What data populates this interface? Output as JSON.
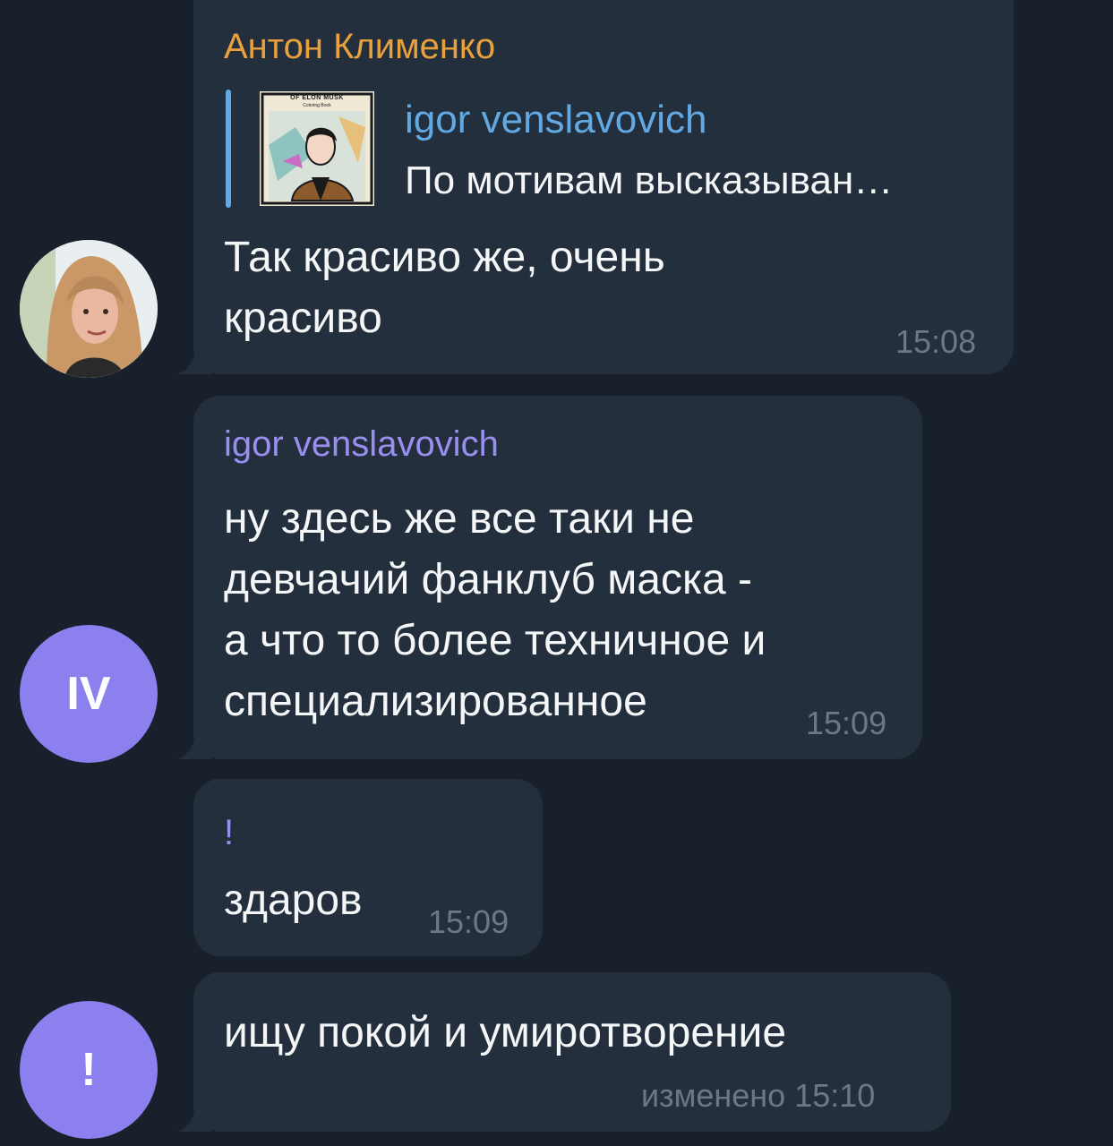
{
  "messages": [
    {
      "sender": "Антон Клименко",
      "sender_color": "#e8a13c",
      "reply": {
        "author": "igor venslavovich",
        "text": "По мотивам высказыван…",
        "thumb_title": "OF ELON MUSK",
        "thumb_subtitle": "Coloring Book"
      },
      "lines": [
        "Так красиво же, очень",
        "красиво"
      ],
      "time": "15:08"
    },
    {
      "sender": "igor venslavovich",
      "sender_color": "#9a8ff1",
      "lines": [
        "ну здесь же все таки не",
        "девчачий фанклуб маска -",
        "а что то более техничное и",
        "специализированное"
      ],
      "time": "15:09",
      "avatar_initials": "IV",
      "avatar_color": "#8c80ee"
    },
    {
      "sender": "!",
      "sender_color": "#9a8ff1",
      "lines": [
        "здаров"
      ],
      "time": "15:09"
    },
    {
      "lines": [
        "ищу покой и умиротворение"
      ],
      "time": "изменено 15:10",
      "avatar_initials": "!",
      "avatar_color": "#8c80ee"
    }
  ]
}
